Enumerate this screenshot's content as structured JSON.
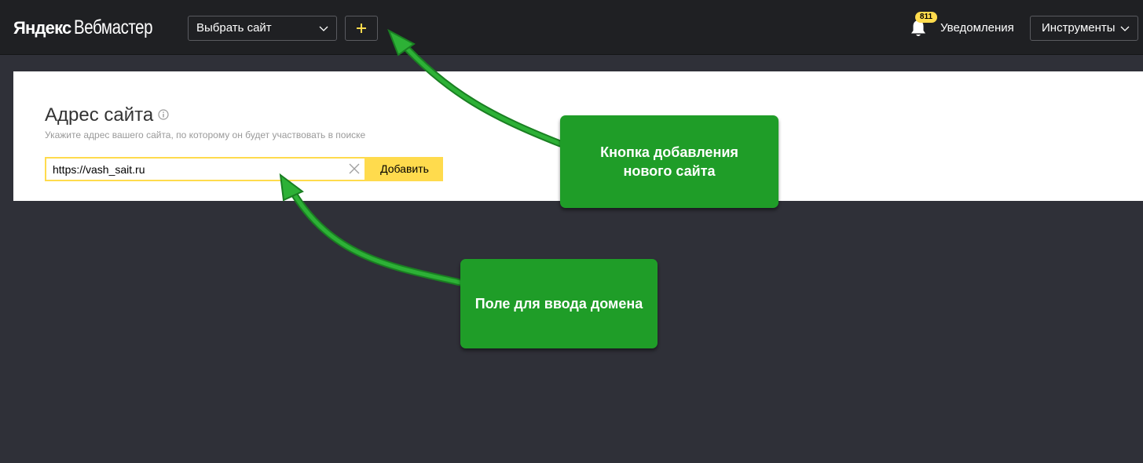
{
  "header": {
    "logo_part1": "Яндекс",
    "logo_part2": "Вебмастер",
    "site_select_label": "Выбрать сайт",
    "add_site_symbol": "+",
    "notifications_count": "811",
    "notifications_label": "Уведомления",
    "tools_label": "Инструменты"
  },
  "form": {
    "title": "Адрес сайта",
    "subtitle": "Укажите адрес вашего сайта, по которому он будет участвовать в поиске",
    "url_value": "https://vash_sait.ru",
    "submit_label": "Добавить"
  },
  "annotations": {
    "add_button_note": "Кнопка добавления нового сайта",
    "input_note": "Поле для ввода домена"
  },
  "colors": {
    "header_bg": "#1f2023",
    "page_bg": "#2f3038",
    "accent_yellow": "#ffdb4d",
    "callout_green": "#1f9d28"
  },
  "icons": [
    "chevron-down-icon",
    "plus-icon",
    "bell-icon",
    "info-icon",
    "clear-icon",
    "arrow-icon"
  ]
}
